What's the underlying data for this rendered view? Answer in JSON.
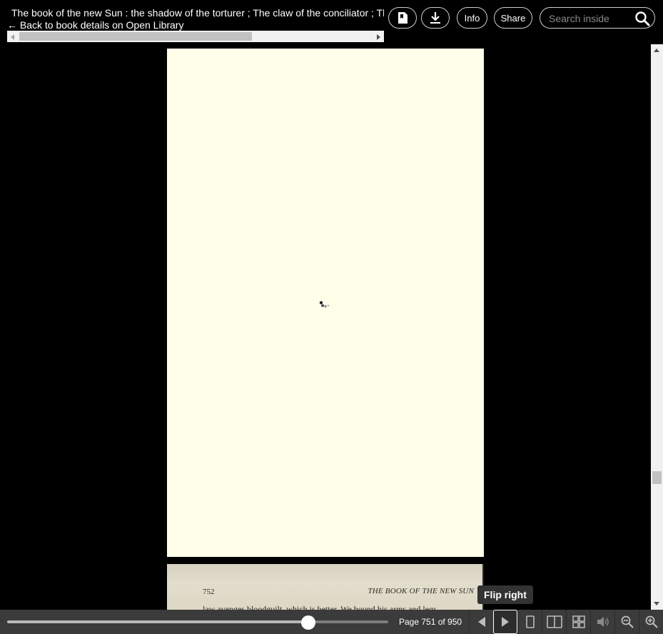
{
  "header": {
    "title": "The book of the new Sun : the shadow of the torturer ; The claw of the conciliator ; The sword of the lictor ; The citadel of the autarch",
    "back_link": "← Back to book details on Open Library",
    "buttons": {
      "bookmark_icon": "bookmark-page-icon",
      "download_icon": "download-icon",
      "info": "Info",
      "share": "Share"
    },
    "search": {
      "placeholder": "Search inside",
      "value": "",
      "icon": "search-icon"
    }
  },
  "viewer": {
    "loading_page_color": "#fefee9",
    "next_page": {
      "page_number": "752",
      "running_head": "THE BOOK OF THE NEW SUN",
      "first_line": "law avenges bloodguilt, which is better. We bound his arms and legs"
    }
  },
  "tooltip": {
    "text": "Flip right"
  },
  "footer": {
    "page_label": "Page 751 of 950",
    "current_page": 751,
    "total_pages": 950,
    "slider_fraction": 0.79,
    "tools": [
      "flip-left-icon",
      "flip-right-icon",
      "one-page-view-icon",
      "two-page-view-icon",
      "thumbnail-view-icon",
      "read-aloud-icon",
      "zoom-out-icon",
      "zoom-in-icon"
    ]
  }
}
